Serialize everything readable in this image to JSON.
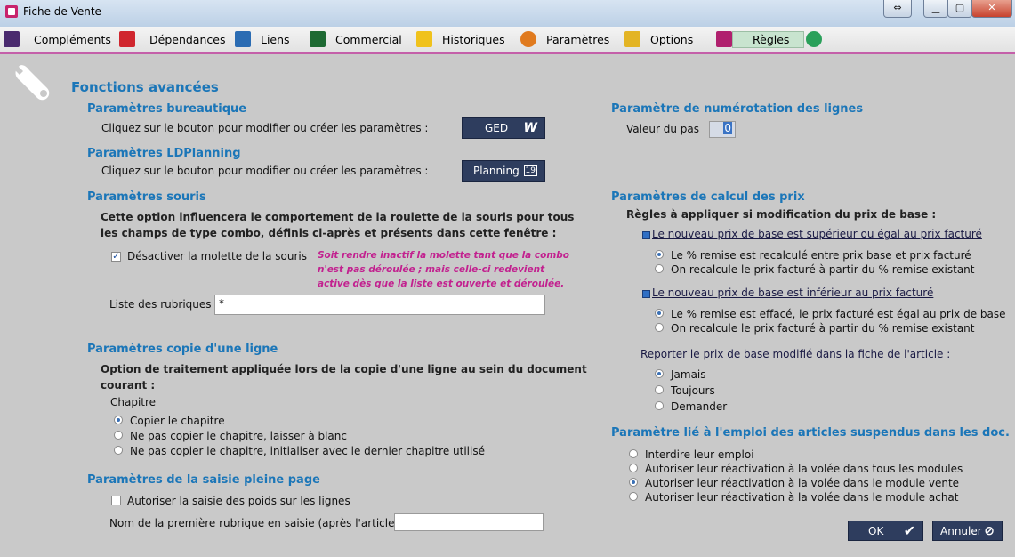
{
  "window": {
    "title": "Fiche de Vente"
  },
  "menu": [
    {
      "label": "Compléments",
      "u": "C",
      "icon": "puzzle-icon",
      "color": "#4a2a6e"
    },
    {
      "label": "Dépendances",
      "u": "D",
      "icon": "tree-icon",
      "color": "#d0262e"
    },
    {
      "label": "Liens",
      "u": "L",
      "icon": "link-icon",
      "color": "#2b6cb3"
    },
    {
      "label": "Commercial",
      "u": "C",
      "icon": "footprints-icon",
      "color": "#1e6a33"
    },
    {
      "label": "Historiques",
      "u": "H",
      "icon": "tower-icon",
      "color": "#f0c21c"
    },
    {
      "label": "Paramètres",
      "u": "P",
      "icon": "gear-icon",
      "color": "#e07a1e"
    },
    {
      "label": "Options",
      "u": "O",
      "icon": "options-icon",
      "color": "#e3b424"
    },
    {
      "label": "Règles",
      "u": "R",
      "icon": "rules-icon",
      "color": "#b0206e"
    }
  ],
  "title_main": "Fonctions avancées",
  "bureautique": {
    "title": "Paramètres bureautique",
    "text": "Cliquez sur le bouton pour modifier ou créer les paramètres :",
    "button": "GED",
    "button_icon": "W"
  },
  "ldplanning": {
    "title": "Paramètres LDPlanning",
    "text": "Cliquez sur le bouton pour modifier ou créer les paramètres :",
    "button": "Planning",
    "button_icon": "19"
  },
  "souris": {
    "title": "Paramètres souris",
    "desc1": "Cette option influencera le comportement de la roulette de la souris pour tous",
    "desc2": "les champs de type combo, définis ci-après et présents dans cette fenêtre :",
    "checkbox": "Désactiver la molette de la souris",
    "note1": "Soit rendre inactif la molette tant que la combo",
    "note2": "n'est pas déroulée ; mais celle-ci redevient",
    "note3": "active dès que la liste est ouverte et déroulée.",
    "list_label": "Liste des rubriques",
    "list_value": "*"
  },
  "copie": {
    "title": "Paramètres copie d'une ligne",
    "desc1": "Option de traitement appliquée lors de la copie d'une ligne au sein du document",
    "desc2": "courant :",
    "chapitre_label": "Chapitre",
    "opt1": "Copier le chapitre",
    "opt2": "Ne pas copier le chapitre, laisser à blanc",
    "opt3": "Ne pas copier le chapitre, initialiser avec le dernier chapitre utilisé"
  },
  "saisie": {
    "title": "Paramètres de la saisie pleine page",
    "checkbox": "Autoriser la saisie des poids sur les lignes",
    "field_label": "Nom de la première rubrique en saisie (après l'article)",
    "field_value": ""
  },
  "numerotation": {
    "title": "Paramètre de numérotation des lignes",
    "label": "Valeur du pas",
    "value": "0"
  },
  "calcul": {
    "title": "Paramètres de calcul des prix",
    "subtitle": "Règles à appliquer si modification du prix de base :",
    "sup_title": "Le nouveau prix de base est supérieur ou égal au prix facturé",
    "sup_opt1": "Le % remise est recalculé entre prix base et prix facturé",
    "sup_opt2": "On recalcule le prix facturé à partir du % remise existant",
    "inf_title": "Le nouveau prix de base est inférieur au prix facturé",
    "inf_opt1": "Le % remise est effacé, le prix facturé est égal au prix de base",
    "inf_opt2": "On recalcule le prix facturé à partir du % remise existant",
    "report_title": "Reporter le prix de base modifié dans la fiche de l'article :",
    "report_opt1": "Jamais",
    "report_opt2": "Toujours",
    "report_opt3": "Demander"
  },
  "suspendus": {
    "title": "Paramètre lié à l'emploi des articles suspendus dans les doc.",
    "opt1": "Interdire leur emploi",
    "opt2": "Autoriser leur réactivation à la volée dans tous les modules",
    "opt3": "Autoriser leur réactivation à la volée dans le module vente",
    "opt4": "Autoriser leur réactivation à la volée dans le module achat"
  },
  "buttons": {
    "ok": "OK",
    "cancel": "Annuler"
  }
}
